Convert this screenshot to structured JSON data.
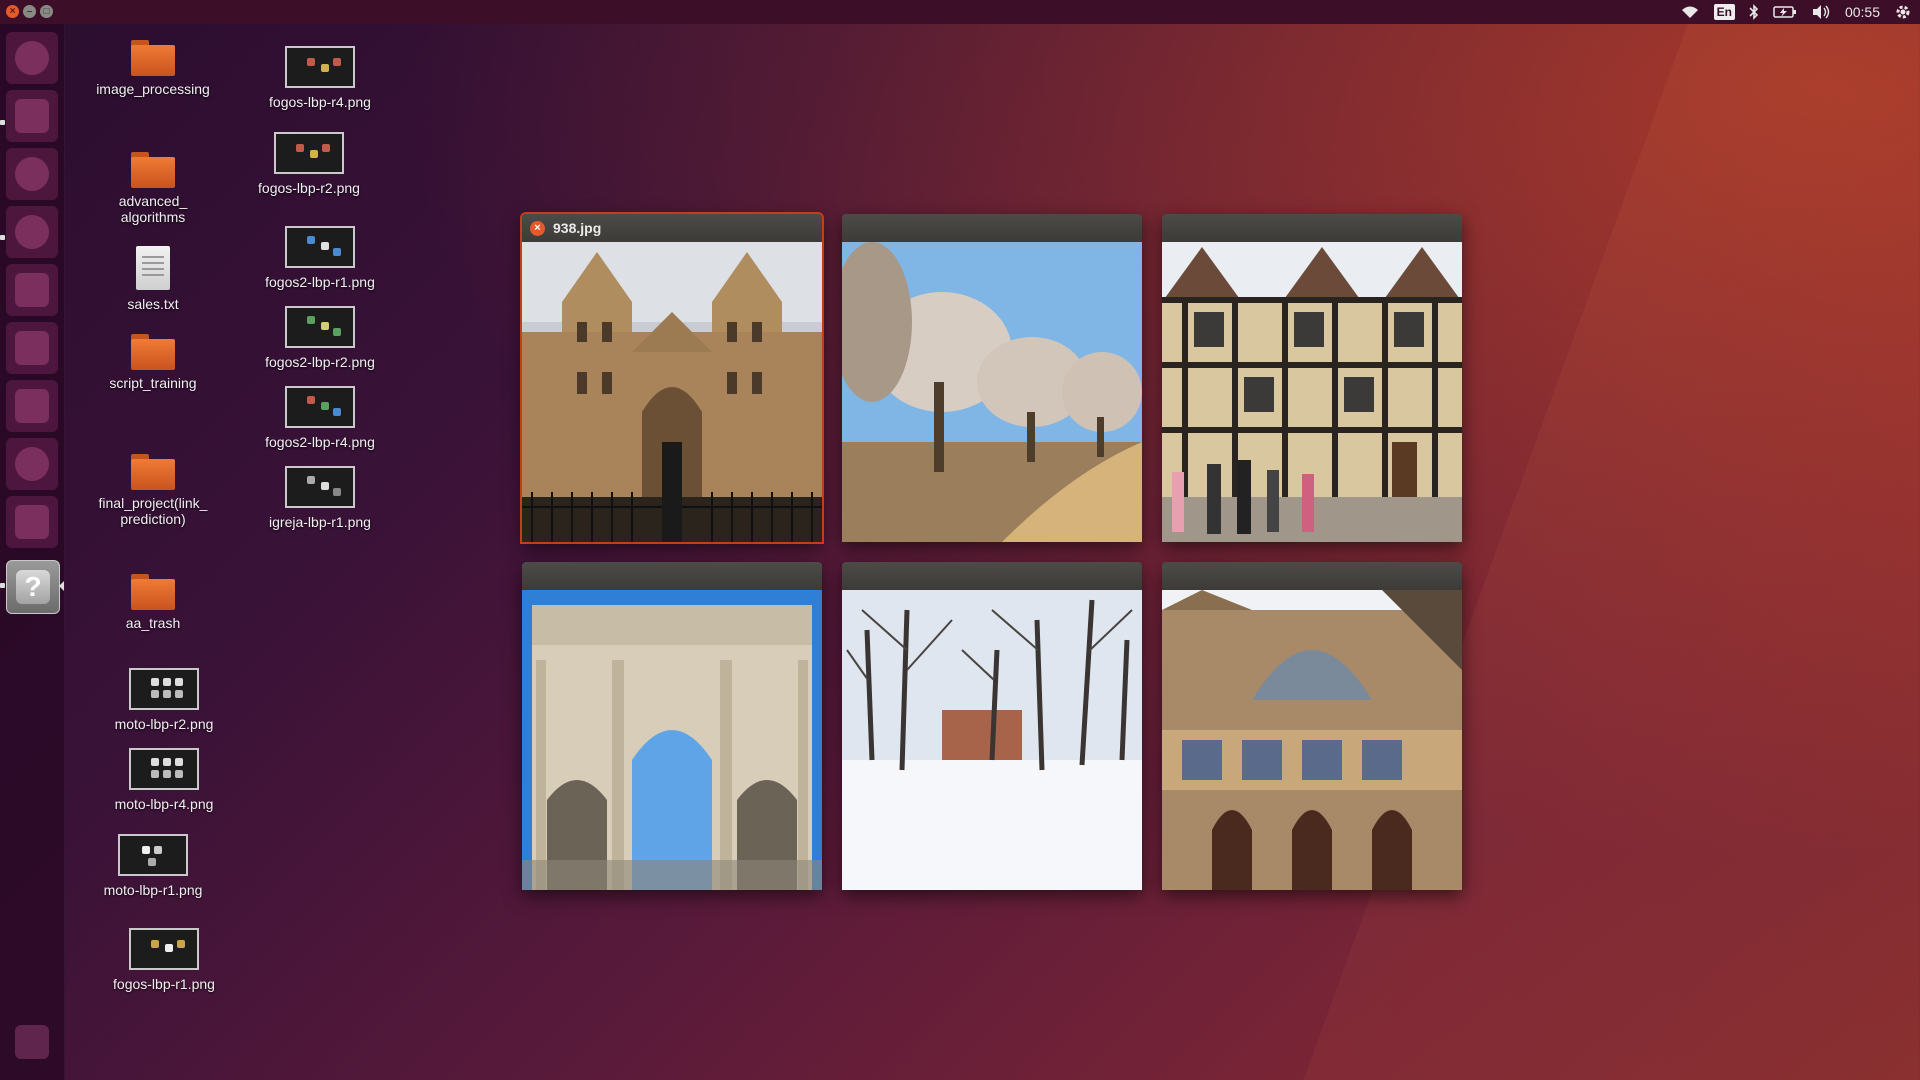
{
  "top_panel": {
    "keyboard_layout": "En",
    "clock": "00:55",
    "icons": [
      "wifi-icon",
      "keyboard-layout-indicator",
      "bluetooth-icon",
      "battery-icon",
      "volume-icon",
      "session-gear-icon"
    ]
  },
  "launcher": {
    "items": [
      "dash-home",
      "files",
      "chromium",
      "firefox",
      "sublime-text",
      "writer",
      "impress",
      "system-settings",
      "software-updater",
      "help"
    ],
    "active_item": "help",
    "active_glyph": "?",
    "trash": "trash"
  },
  "desktop": {
    "col1": [
      {
        "label": "image_processing",
        "type": "folder"
      },
      {
        "label": "advanced_\nalgorithms",
        "type": "folder"
      },
      {
        "label": "sales.txt",
        "type": "text"
      },
      {
        "label": "script_training",
        "type": "folder"
      },
      {
        "label": "final_project(link_\nprediction)",
        "type": "folder"
      },
      {
        "label": "aa_trash",
        "type": "folder"
      },
      {
        "label": "moto-lbp-r2.png",
        "type": "image"
      },
      {
        "label": "moto-lbp-r4.png",
        "type": "image"
      },
      {
        "label": "moto-lbp-r1.png",
        "type": "image"
      },
      {
        "label": "fogos-lbp-r1.png",
        "type": "image"
      }
    ],
    "col2": [
      {
        "label": "fogos-lbp-r4.png",
        "type": "image"
      },
      {
        "label": "fogos-lbp-r2.png",
        "type": "image"
      },
      {
        "label": "fogos2-lbp-r1.png",
        "type": "image"
      },
      {
        "label": "fogos2-lbp-r2.png",
        "type": "image"
      },
      {
        "label": "fogos2-lbp-r4.png",
        "type": "image"
      },
      {
        "label": "igreja-lbp-r1.png",
        "type": "image"
      }
    ]
  },
  "spread": {
    "windows": [
      {
        "title": "938.jpg",
        "focused": true,
        "scene": "cathedral-towers"
      },
      {
        "title": "",
        "focused": false,
        "scene": "frosted-trees-desert"
      },
      {
        "title": "",
        "focused": false,
        "scene": "tudor-house"
      },
      {
        "title": "",
        "focused": false,
        "scene": "triumphal-arch"
      },
      {
        "title": "",
        "focused": false,
        "scene": "snowy-park"
      },
      {
        "title": "",
        "focused": false,
        "scene": "gothic-church-facade"
      }
    ]
  }
}
